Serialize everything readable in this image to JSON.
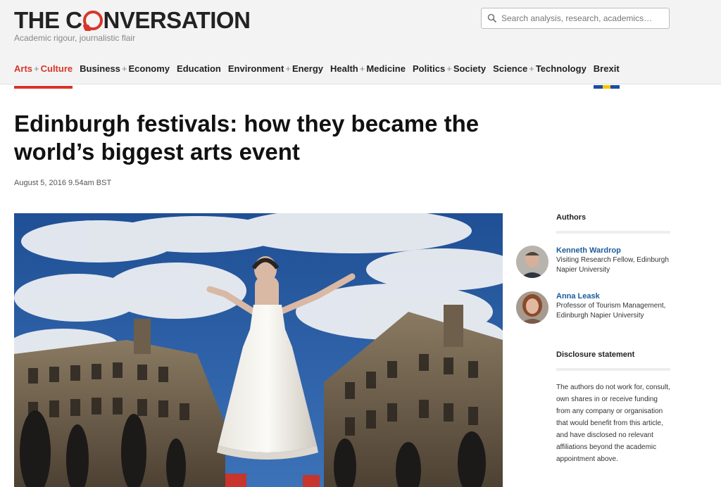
{
  "header": {
    "logo_pre": "THE C",
    "logo_post": "NVERSATION",
    "tagline": "Academic rigour, journalistic flair",
    "search_placeholder": "Search analysis, research, academics…",
    "accent_color": "#d8352a"
  },
  "nav": [
    {
      "a": "Arts",
      "b": "Culture",
      "active": true
    },
    {
      "a": "Business",
      "b": "Economy"
    },
    {
      "a": "Education"
    },
    {
      "a": "Environment",
      "b": "Energy"
    },
    {
      "a": "Health",
      "b": "Medicine"
    },
    {
      "a": "Politics",
      "b": "Society"
    },
    {
      "a": "Science",
      "b": "Technology"
    },
    {
      "a": "Brexit"
    }
  ],
  "article": {
    "title": "Edinburgh festivals: how they became the world’s biggest arts event",
    "date": "August 5, 2016 9.54am BST"
  },
  "sidebar": {
    "authors_heading": "Authors",
    "authors": [
      {
        "name": "Kenneth Wardrop",
        "role": "Visiting Research Fellow, Edinburgh Napier University"
      },
      {
        "name": "Anna Leask",
        "role": "Professor of Tourism Management, Edinburgh Napier University"
      }
    ],
    "disclosure_heading": "Disclosure statement",
    "disclosure_text": "The authors do not work for, consult, own shares in or receive funding from any company or organisation that would benefit from this article, and have disclosed no relevant affiliations beyond the academic appointment above."
  }
}
